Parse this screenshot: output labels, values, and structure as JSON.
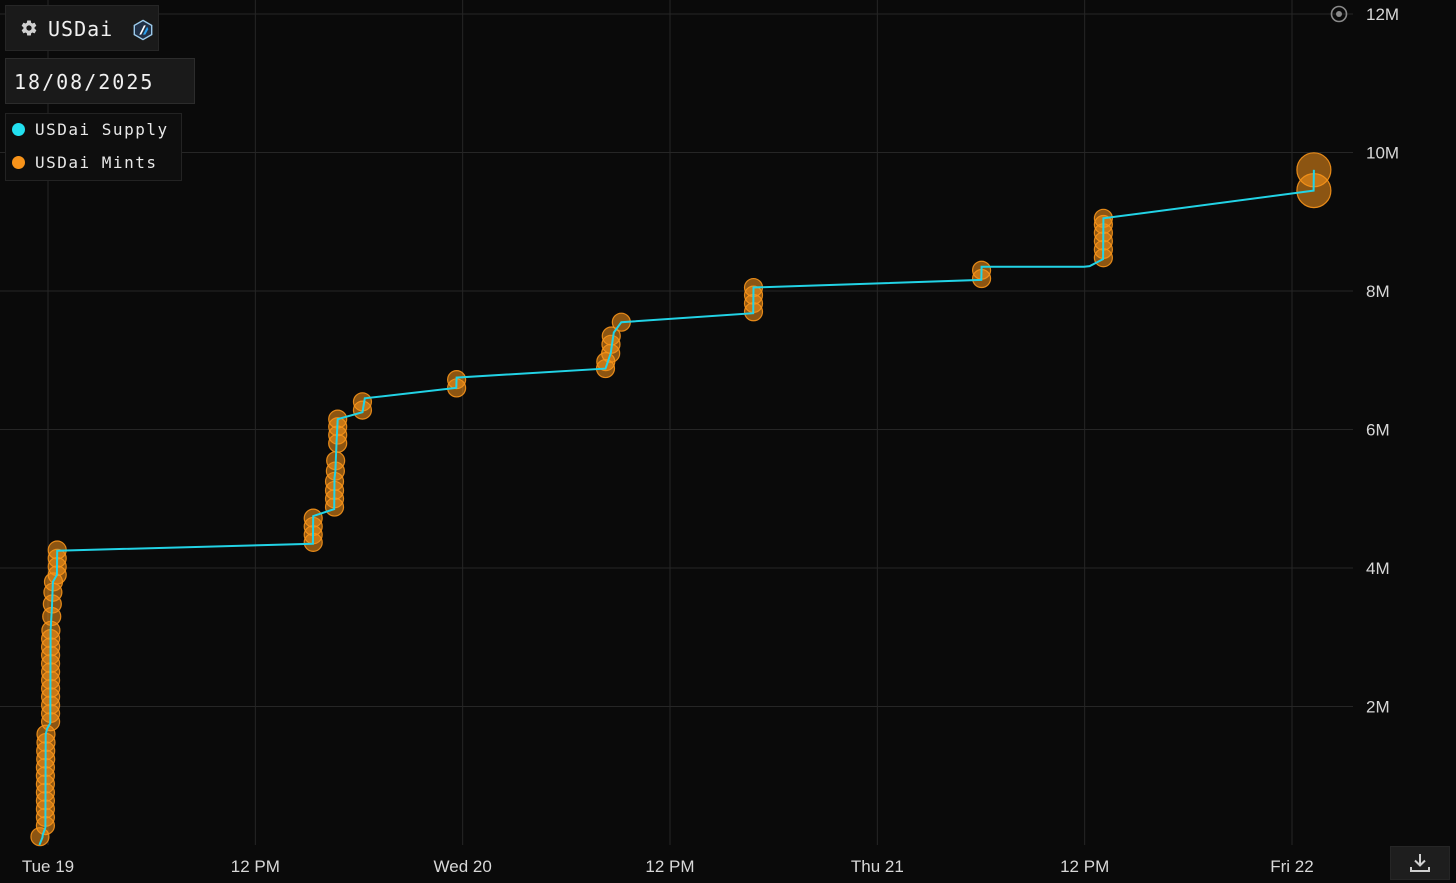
{
  "header": {
    "title": "USDai"
  },
  "date_picker": {
    "value": "18/08/2025"
  },
  "colors": {
    "supply": "#22d3e6",
    "mints": "#f7931a",
    "background": "#0a0a0a",
    "grid": "#262626"
  },
  "icons": {
    "settings": "gear-icon",
    "network": "arbitrum-icon",
    "reset": "reset-zoom-icon",
    "download": "download-icon"
  },
  "chart_data": {
    "type": "line",
    "legend": [
      "USDai Supply",
      "USDai Mints"
    ],
    "legend_position": "top-left",
    "grid": true,
    "ylim": [
      0,
      12000000
    ],
    "y_ticks": [
      {
        "value": 2000000,
        "label": "2M"
      },
      {
        "value": 4000000,
        "label": "4M"
      },
      {
        "value": 6000000,
        "label": "6M"
      },
      {
        "value": 8000000,
        "label": "8M"
      },
      {
        "value": 10000000,
        "label": "10M"
      },
      {
        "value": 12000000,
        "label": "12M"
      }
    ],
    "xlim": [
      "2025-08-18T23:30",
      "2025-08-22T01:40"
    ],
    "x_ticks": [
      {
        "value": "2025-08-19T00:00",
        "label": "Tue 19"
      },
      {
        "value": "2025-08-19T12:00",
        "label": "12 PM"
      },
      {
        "value": "2025-08-20T00:00",
        "label": "Wed 20"
      },
      {
        "value": "2025-08-20T12:00",
        "label": "12 PM"
      },
      {
        "value": "2025-08-21T00:00",
        "label": "Thu 21"
      },
      {
        "value": "2025-08-21T12:00",
        "label": "12 PM"
      },
      {
        "value": "2025-08-22T00:00",
        "label": "Fri 22"
      }
    ],
    "series": [
      {
        "name": "USDai Supply",
        "points": [
          [
            "2025-08-18T23:30",
            0
          ],
          [
            "2025-08-18T23:41",
            110000
          ],
          [
            "2025-08-18T23:42",
            150000
          ],
          [
            "2025-08-18T23:51",
            250000
          ],
          [
            "2025-08-18T23:52",
            1600000
          ],
          [
            "2025-08-18T23:57",
            1680000
          ],
          [
            "2025-08-19T00:08",
            1760000
          ],
          [
            "2025-08-19T00:09",
            3100000
          ],
          [
            "2025-08-19T00:14",
            3450000
          ],
          [
            "2025-08-19T00:17",
            3800000
          ],
          [
            "2025-08-19T00:31",
            3900000
          ],
          [
            "2025-08-19T00:32",
            4250000
          ],
          [
            "2025-08-19T15:20",
            4350000
          ],
          [
            "2025-08-19T15:21",
            4750000
          ],
          [
            "2025-08-19T16:34",
            4850000
          ],
          [
            "2025-08-19T16:35",
            5300000
          ],
          [
            "2025-08-19T16:38",
            5400000
          ],
          [
            "2025-08-19T16:42",
            5800000
          ],
          [
            "2025-08-19T16:46",
            6150000
          ],
          [
            "2025-08-19T18:12",
            6250000
          ],
          [
            "2025-08-19T18:20",
            6450000
          ],
          [
            "2025-08-19T23:38",
            6600000
          ],
          [
            "2025-08-19T23:39",
            6750000
          ],
          [
            "2025-08-20T08:16",
            6880000
          ],
          [
            "2025-08-20T08:34",
            7100000
          ],
          [
            "2025-08-20T08:45",
            7400000
          ],
          [
            "2025-08-20T09:11",
            7550000
          ],
          [
            "2025-08-20T16:49",
            7680000
          ],
          [
            "2025-08-20T16:50",
            8050000
          ],
          [
            "2025-08-21T06:01",
            8160000
          ],
          [
            "2025-08-21T06:02",
            8350000
          ],
          [
            "2025-08-21T06:44",
            8350000
          ],
          [
            "2025-08-21T11:58",
            8350000
          ],
          [
            "2025-08-21T12:17",
            8360000
          ],
          [
            "2025-08-21T13:04",
            8460000
          ],
          [
            "2025-08-21T13:05",
            9050000
          ],
          [
            "2025-08-22T01:15",
            9450000
          ],
          [
            "2025-08-22T01:16",
            9750000
          ]
        ]
      },
      {
        "name": "USDai Mints",
        "points": [
          [
            "2025-08-18T23:32",
            120000
          ],
          [
            "2025-08-18T23:51",
            280000
          ],
          [
            "2025-08-18T23:51",
            400000
          ],
          [
            "2025-08-18T23:51",
            520000
          ],
          [
            "2025-08-18T23:51",
            640000
          ],
          [
            "2025-08-18T23:51",
            760000
          ],
          [
            "2025-08-18T23:51",
            880000
          ],
          [
            "2025-08-18T23:51",
            1000000
          ],
          [
            "2025-08-18T23:51",
            1120000
          ],
          [
            "2025-08-18T23:52",
            1240000
          ],
          [
            "2025-08-18T23:52",
            1360000
          ],
          [
            "2025-08-18T23:53",
            1480000
          ],
          [
            "2025-08-18T23:53",
            1600000
          ],
          [
            "2025-08-19T00:09",
            1780000
          ],
          [
            "2025-08-19T00:09",
            1900000
          ],
          [
            "2025-08-19T00:09",
            2020000
          ],
          [
            "2025-08-19T00:09",
            2140000
          ],
          [
            "2025-08-19T00:09",
            2260000
          ],
          [
            "2025-08-19T00:09",
            2380000
          ],
          [
            "2025-08-19T00:09",
            2500000
          ],
          [
            "2025-08-19T00:09",
            2620000
          ],
          [
            "2025-08-19T00:09",
            2740000
          ],
          [
            "2025-08-19T00:09",
            2860000
          ],
          [
            "2025-08-19T00:09",
            2980000
          ],
          [
            "2025-08-19T00:10",
            3100000
          ],
          [
            "2025-08-19T00:13",
            3300000
          ],
          [
            "2025-08-19T00:15",
            3480000
          ],
          [
            "2025-08-19T00:17",
            3650000
          ],
          [
            "2025-08-19T00:19",
            3800000
          ],
          [
            "2025-08-19T00:32",
            3900000
          ],
          [
            "2025-08-19T00:32",
            4020000
          ],
          [
            "2025-08-19T00:32",
            4140000
          ],
          [
            "2025-08-19T00:32",
            4260000
          ],
          [
            "2025-08-19T15:21",
            4370000
          ],
          [
            "2025-08-19T15:21",
            4480000
          ],
          [
            "2025-08-19T15:21",
            4600000
          ],
          [
            "2025-08-19T15:21",
            4720000
          ],
          [
            "2025-08-19T16:35",
            4880000
          ],
          [
            "2025-08-19T16:35",
            5000000
          ],
          [
            "2025-08-19T16:35",
            5120000
          ],
          [
            "2025-08-19T16:35",
            5250000
          ],
          [
            "2025-08-19T16:38",
            5400000
          ],
          [
            "2025-08-19T16:39",
            5550000
          ],
          [
            "2025-08-19T16:46",
            5800000
          ],
          [
            "2025-08-19T16:46",
            5920000
          ],
          [
            "2025-08-19T16:46",
            6040000
          ],
          [
            "2025-08-19T16:46",
            6150000
          ],
          [
            "2025-08-19T18:12",
            6280000
          ],
          [
            "2025-08-19T18:12",
            6400000
          ],
          [
            "2025-08-19T23:39",
            6600000
          ],
          [
            "2025-08-19T23:39",
            6720000
          ],
          [
            "2025-08-20T08:16",
            6880000
          ],
          [
            "2025-08-20T08:17",
            6980000
          ],
          [
            "2025-08-20T08:34",
            7100000
          ],
          [
            "2025-08-20T08:35",
            7230000
          ],
          [
            "2025-08-20T08:36",
            7350000
          ],
          [
            "2025-08-20T09:11",
            7550000
          ],
          [
            "2025-08-20T16:50",
            7700000
          ],
          [
            "2025-08-20T16:50",
            7820000
          ],
          [
            "2025-08-20T16:50",
            7940000
          ],
          [
            "2025-08-20T16:50",
            8050000
          ],
          [
            "2025-08-21T06:02",
            8180000
          ],
          [
            "2025-08-21T06:02",
            8300000
          ],
          [
            "2025-08-21T13:05",
            8480000
          ],
          [
            "2025-08-21T13:05",
            8600000
          ],
          [
            "2025-08-21T13:05",
            8720000
          ],
          [
            "2025-08-21T13:05",
            8840000
          ],
          [
            "2025-08-21T13:05",
            8960000
          ],
          [
            "2025-08-21T13:05",
            9050000
          ],
          [
            "2025-08-22T01:16",
            9450000
          ],
          [
            "2025-08-22T01:16",
            9750000
          ]
        ]
      }
    ]
  }
}
